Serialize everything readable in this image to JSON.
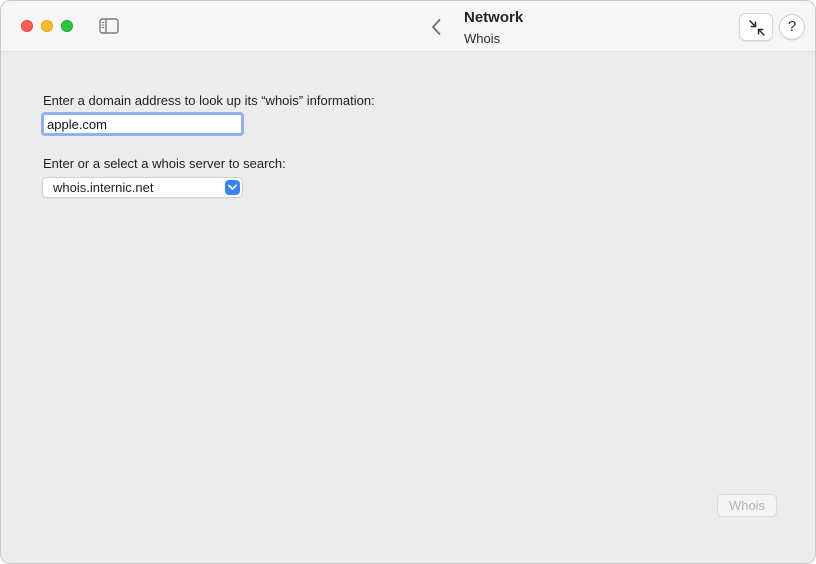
{
  "window": {
    "title": "Network",
    "subtitle": "Whois"
  },
  "toolbar": {
    "help_label": "?",
    "icons": [
      "sidebar-toggle-icon",
      "chevron-left-icon",
      "collapse-arrows-icon",
      "question-mark-icon"
    ]
  },
  "form": {
    "domain_label": "Enter a domain address to look up its “whois” information:",
    "domain_value": "apple.com",
    "server_label": "Enter or a select a whois server to search:",
    "server_value": "whois.internic.net"
  },
  "actions": {
    "whois_button_label": "Whois",
    "whois_button_enabled": false
  },
  "colors": {
    "close": "#ff5f57",
    "minimize": "#febc2e",
    "zoom": "#28c840",
    "focus_ring": "#8fb1f2",
    "accent": "#3a82f7"
  }
}
